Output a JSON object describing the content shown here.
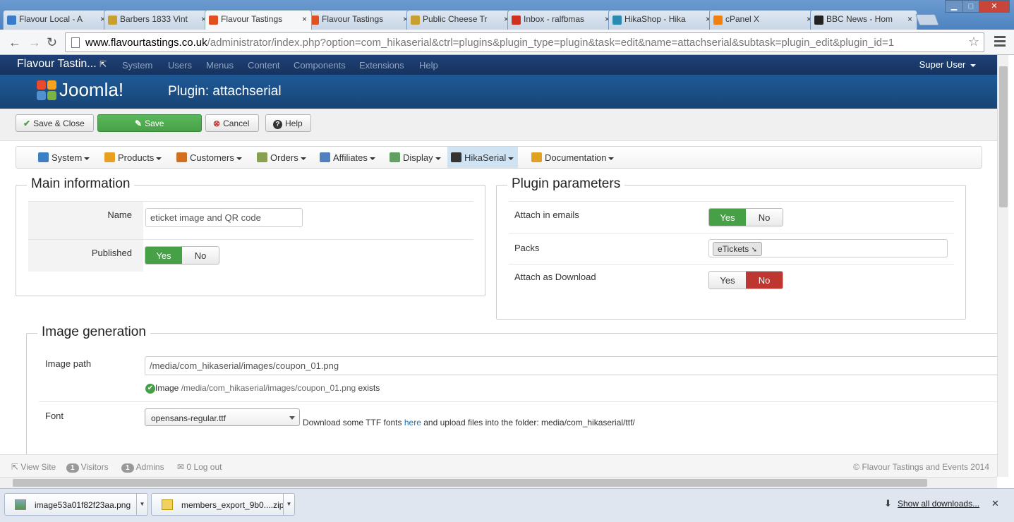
{
  "browser": {
    "tabs": [
      {
        "label": "Flavour Local - A",
        "icon_color": "#3a7bc8",
        "icon": "joomla-icon"
      },
      {
        "label": "Barbers 1833 Vint",
        "icon_color": "#c8a030",
        "icon": "box-icon"
      },
      {
        "label": "Flavour Tastings",
        "icon_color": "#e05020",
        "icon": "joomla-icon",
        "active": true
      },
      {
        "label": "Flavour Tastings",
        "icon_color": "#e05020",
        "icon": "joomla-icon"
      },
      {
        "label": "Public Cheese Tr",
        "icon_color": "#c8a030",
        "icon": "box-icon"
      },
      {
        "label": "Inbox - ralfbmas",
        "icon_color": "#d03020",
        "icon": "gmail-icon"
      },
      {
        "label": "HikaShop - Hika",
        "icon_color": "#2a8ab0",
        "icon": "hikashop-icon"
      },
      {
        "label": "cPanel X",
        "icon_color": "#f08010",
        "icon": "cpanel-icon"
      },
      {
        "label": "BBC News - Hom",
        "icon_color": "#222222",
        "icon": "bbc-icon"
      }
    ],
    "tab_close": "×",
    "url_host": "www.flavourtastings.co.uk",
    "url_path": "/administrator/index.php?option=com_hikaserial&ctrl=plugins&plugin_type=plugin&task=edit&name=attachserial&subtask=plugin_edit&plugin_id=1",
    "star": "☆",
    "back": "←",
    "forward": "→",
    "reload": "↻",
    "win_min": "▁",
    "win_max": "□",
    "win_close": "✕"
  },
  "joomla_nav": {
    "brand": "Flavour Tastin...",
    "external_icon": "⇱",
    "items": [
      "System",
      "Users",
      "Menus",
      "Content",
      "Components",
      "Extensions",
      "Help"
    ],
    "user": "Super User"
  },
  "header": {
    "logo_text": "Joomla!",
    "title": "Plugin: attachserial"
  },
  "toolbar": {
    "save_close": "Save & Close",
    "save": "Save",
    "cancel": "Cancel",
    "help": "Help",
    "save_close_icon": "✔",
    "save_icon": "✎",
    "cancel_icon": "⊗",
    "help_icon": "?"
  },
  "hika_menu": [
    {
      "label": "System",
      "icon": "tools-icon",
      "color": "#3d7fc4"
    },
    {
      "label": "Products",
      "icon": "box-icon",
      "color": "#e8a020"
    },
    {
      "label": "Customers",
      "icon": "users-icon",
      "color": "#d07020"
    },
    {
      "label": "Orders",
      "icon": "orders-icon",
      "color": "#88a050"
    },
    {
      "label": "Affiliates",
      "icon": "affiliates-icon",
      "color": "#5080c0"
    },
    {
      "label": "Display",
      "icon": "display-icon",
      "color": "#60a060"
    },
    {
      "label": "HikaSerial",
      "icon": "hikaserial-icon",
      "color": "#333333",
      "active": true
    },
    {
      "label": "Documentation",
      "icon": "documentation-icon",
      "color": "#e0a020"
    }
  ],
  "main_info": {
    "legend": "Main information",
    "name_label": "Name",
    "name_value": "eticket image and QR  code",
    "published_label": "Published",
    "yes": "Yes",
    "no": "No",
    "published": "yes"
  },
  "plugin_params": {
    "legend": "Plugin parameters",
    "attach_emails_label": "Attach in emails",
    "attach_emails": "yes",
    "packs_label": "Packs",
    "packs_chip": "eTickets",
    "attach_download_label": "Attach as Download",
    "attach_download": "no",
    "yes": "Yes",
    "no": "No"
  },
  "image_gen": {
    "legend": "Image generation",
    "image_path_label": "Image path",
    "image_path_value": "/media/com_hikaserial/images/coupon_01.png",
    "exists_prefix": "Image",
    "exists_path": "/media/com_hikaserial/images/coupon_01.png",
    "exists_suffix": "exists",
    "font_label": "Font",
    "font_value": "opensans-regular.ttf",
    "font_help_prefix": "Download some TTF fonts",
    "font_help_link": "here",
    "font_help_suffix": "and upload files into the folder: media/com_hikaserial/ttf/"
  },
  "status_bar": {
    "view_site": "View Site",
    "visitors_count": "1",
    "visitors": "Visitors",
    "admins_count": "1",
    "admins": "Admins",
    "logout_count": "0",
    "logout": "Log out",
    "copyright": "© Flavour Tastings and Events 2014"
  },
  "downloads": {
    "items": [
      "image53a01f82f23aa.png",
      "members_export_9b0....zip"
    ],
    "show_all": "Show all downloads...",
    "close": "✕",
    "download_icon": "⬇"
  }
}
